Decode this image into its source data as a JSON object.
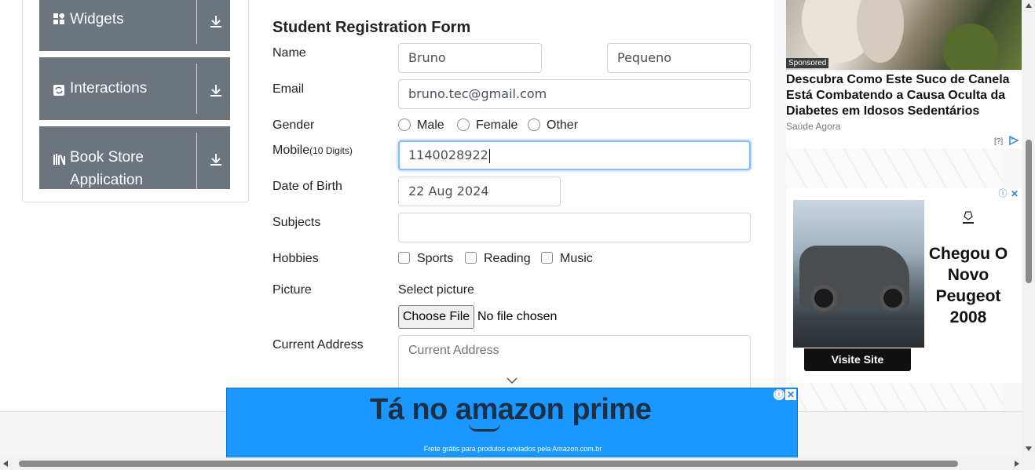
{
  "sidebar": {
    "groups": [
      {
        "label": "Widgets",
        "icon": "widgets-icon"
      },
      {
        "label": "Interactions",
        "icon": "interactions-icon"
      },
      {
        "label": "Book Store\nApplication",
        "icon": "book-store-icon"
      }
    ]
  },
  "form": {
    "title": "Student Registration Form",
    "name_label": "Name",
    "first_name": "Bruno",
    "last_name": "Pequeno",
    "email_label": "Email",
    "email": "bruno.tec@gmail.com",
    "gender_label": "Gender",
    "gender_options": [
      "Male",
      "Female",
      "Other"
    ],
    "mobile_label": "Mobile",
    "mobile_hint": "(10 Digits)",
    "mobile": "1140028922",
    "dob_label": "Date of Birth",
    "dob": "22 Aug 2024",
    "subjects_label": "Subjects",
    "hobbies_label": "Hobbies",
    "hobby_options": [
      "Sports",
      "Reading",
      "Music"
    ],
    "picture_label": "Picture",
    "picture_prompt": "Select picture",
    "choose_file": "Choose File",
    "no_file": "No file chosen",
    "address_label": "Current Address",
    "address_placeholder": "Current Address"
  },
  "ads": {
    "sponsored": "Sponsored",
    "ad1_headline": "Descubra Como Este Suco de Canela Está Combatendo a Causa Oculta da Diabetes em Idosos Sedentários",
    "ad1_source": "Saúde Agora",
    "ad1_choice": "[?]",
    "ad2_text": "Chegou O Novo Peugeot 2008",
    "ad2_button": "Visite Site",
    "amazon_headline": "Tá no amazon prime",
    "amazon_sub": "Frete grátis para produtos enviados pela Amazon.com.br"
  },
  "colors": {
    "sidebar_bg": "#6c757d",
    "focus_border": "#80bdff",
    "amazon_bg": "#1a98ff"
  }
}
